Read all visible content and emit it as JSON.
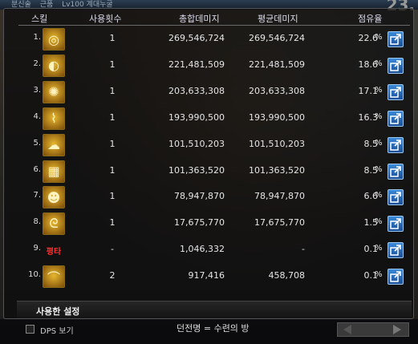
{
  "topbar": {
    "items": [
      "분신술",
      "근품",
      "Lv100 계대누굴"
    ],
    "corner": "23."
  },
  "headers": {
    "skill": "스킬",
    "uses": "사용횟수",
    "total": "총합데미지",
    "avg": "평균데미지",
    "share": "점유율"
  },
  "rows": [
    {
      "num": "1.",
      "icon": "vortex-skill-icon",
      "glyph": "◎",
      "uses": "1",
      "total": "269,546,724",
      "avg": "269,546,724",
      "pct": "22.6",
      "pct_sign": "%"
    },
    {
      "num": "2.",
      "icon": "crescent-skill-icon",
      "glyph": "◐",
      "uses": "1",
      "total": "221,481,509",
      "avg": "221,481,509",
      "pct": "18.6",
      "pct_sign": "%"
    },
    {
      "num": "3.",
      "icon": "sunburst-skill-icon",
      "glyph": "✺",
      "uses": "1",
      "total": "203,633,308",
      "avg": "203,633,308",
      "pct": "17.1",
      "pct_sign": "%"
    },
    {
      "num": "4.",
      "icon": "claw-skill-icon",
      "glyph": "⌇",
      "uses": "1",
      "total": "193,990,500",
      "avg": "193,990,500",
      "pct": "16.3",
      "pct_sign": "%"
    },
    {
      "num": "5.",
      "icon": "cloud-skill-icon",
      "glyph": "☁",
      "uses": "1",
      "total": "101,510,203",
      "avg": "101,510,203",
      "pct": "8.5",
      "pct_sign": "%"
    },
    {
      "num": "6.",
      "icon": "net-skill-icon",
      "glyph": "▦",
      "uses": "1",
      "total": "101,363,520",
      "avg": "101,363,520",
      "pct": "8.5",
      "pct_sign": "%"
    },
    {
      "num": "7.",
      "icon": "face-skill-icon",
      "glyph": "☻",
      "uses": "1",
      "total": "78,947,870",
      "avg": "78,947,870",
      "pct": "6.6",
      "pct_sign": "%"
    },
    {
      "num": "8.",
      "icon": "spiral-skill-icon",
      "glyph": "ᘓ",
      "uses": "1",
      "total": "17,675,770",
      "avg": "17,675,770",
      "pct": "1.5",
      "pct_sign": "%"
    },
    {
      "num": "9.",
      "icon": "text-skill-icon",
      "glyph": "평타",
      "uses": "-",
      "total": "1,046,332",
      "avg": "-",
      "pct": "0.1",
      "pct_sign": "%"
    },
    {
      "num": "10.",
      "icon": "staff-skill-icon",
      "glyph": "⌒",
      "uses": "2",
      "total": "917,416",
      "avg": "458,708",
      "pct": "0.1",
      "pct_sign": "%"
    }
  ],
  "settings_label": "사용한 설정",
  "footer": {
    "dps_label": "DPS 보기",
    "dungeon": "던전명 = 수련의 방"
  },
  "colors": {
    "accent": "#2a6fc4",
    "icon_border": "#8a6b1a"
  }
}
